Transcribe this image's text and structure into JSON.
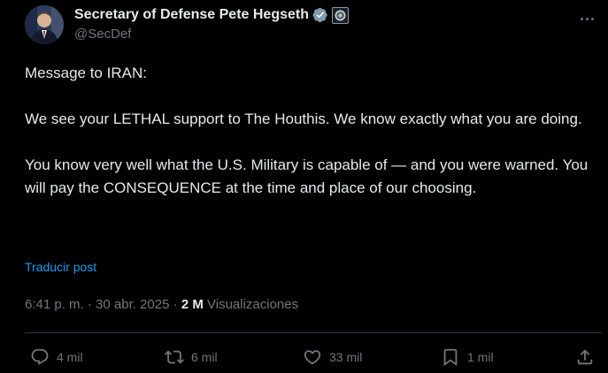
{
  "author": {
    "display_name": "Secretary of Defense Pete Hegseth",
    "handle": "@SecDef",
    "avatar_icon": "profile-photo",
    "verified_icon": "verified-checkmark-icon",
    "affiliate_icon": "government-seal-icon",
    "verified_color": "#829aab"
  },
  "more_icon": "more-dots-icon",
  "tweet": {
    "paragraphs": [
      "Message to IRAN:",
      "We see your LETHAL support to The Houthis. We know exactly what you are doing.",
      "You know very well what the U.S. Military is capable of — and you were warned. You will pay the CONSEQUENCE at the time and place of our choosing."
    ],
    "translate_label": "Traducir post"
  },
  "meta": {
    "time": "6:41 p. m.",
    "separator": "·",
    "date": "30 abr. 2025",
    "views_count": "2 M",
    "views_label": "Visualizaciones"
  },
  "actions": {
    "reply": {
      "icon": "reply-icon",
      "count": "4 mil"
    },
    "repost": {
      "icon": "repost-icon",
      "count": "6 mil"
    },
    "like": {
      "icon": "heart-icon",
      "count": "33 mil"
    },
    "bookmark": {
      "icon": "bookmark-icon",
      "count": "1 mil"
    },
    "share": {
      "icon": "share-icon"
    }
  },
  "colors": {
    "background": "#000000",
    "text": "#e7e9ea",
    "muted": "#71767b",
    "link": "#1d9bf0",
    "divider": "#2f3336"
  }
}
